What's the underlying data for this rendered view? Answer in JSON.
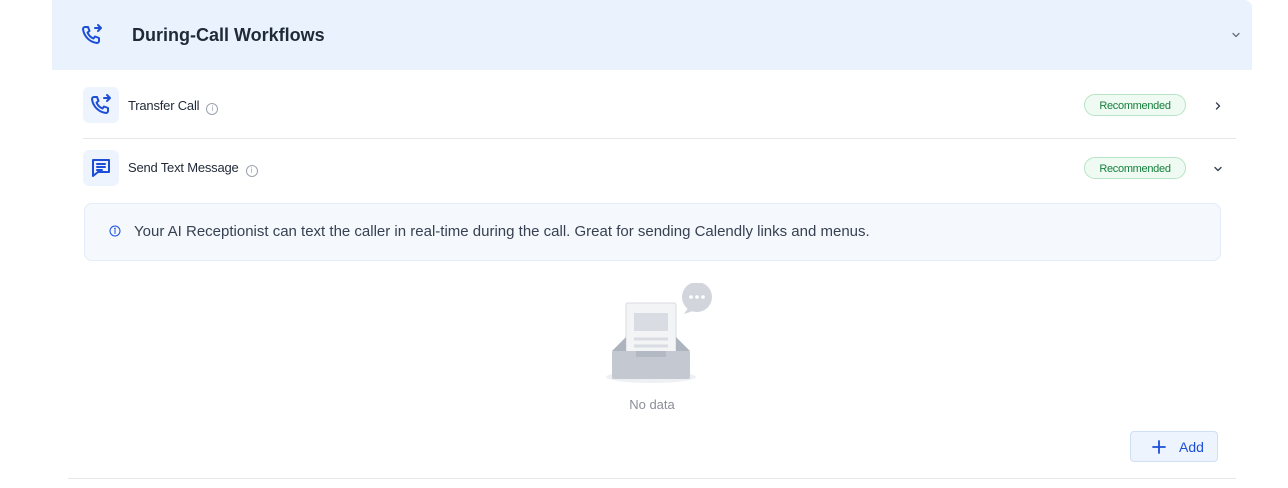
{
  "section": {
    "title": "During-Call Workflows",
    "icon": "phone-transfer-icon",
    "expanded": true
  },
  "items": [
    {
      "label": "Transfer Call",
      "icon": "phone-transfer-icon",
      "badge": "Recommended",
      "chevron": ">",
      "expanded": false
    },
    {
      "label": "Send Text Message",
      "icon": "message-icon",
      "badge": "Recommended",
      "chevron": "v",
      "expanded": true
    }
  ],
  "sms_panel": {
    "info_text": "Your AI Receptionist can text the caller in real-time during the call. Great for sending Calendly links and menus.",
    "empty_text": "No data",
    "add_label": "Add"
  },
  "colors": {
    "header_bg": "#eaf3fd",
    "accent": "#1d4ed8",
    "badge_text": "#15803d",
    "badge_bg": "#effaf2"
  }
}
